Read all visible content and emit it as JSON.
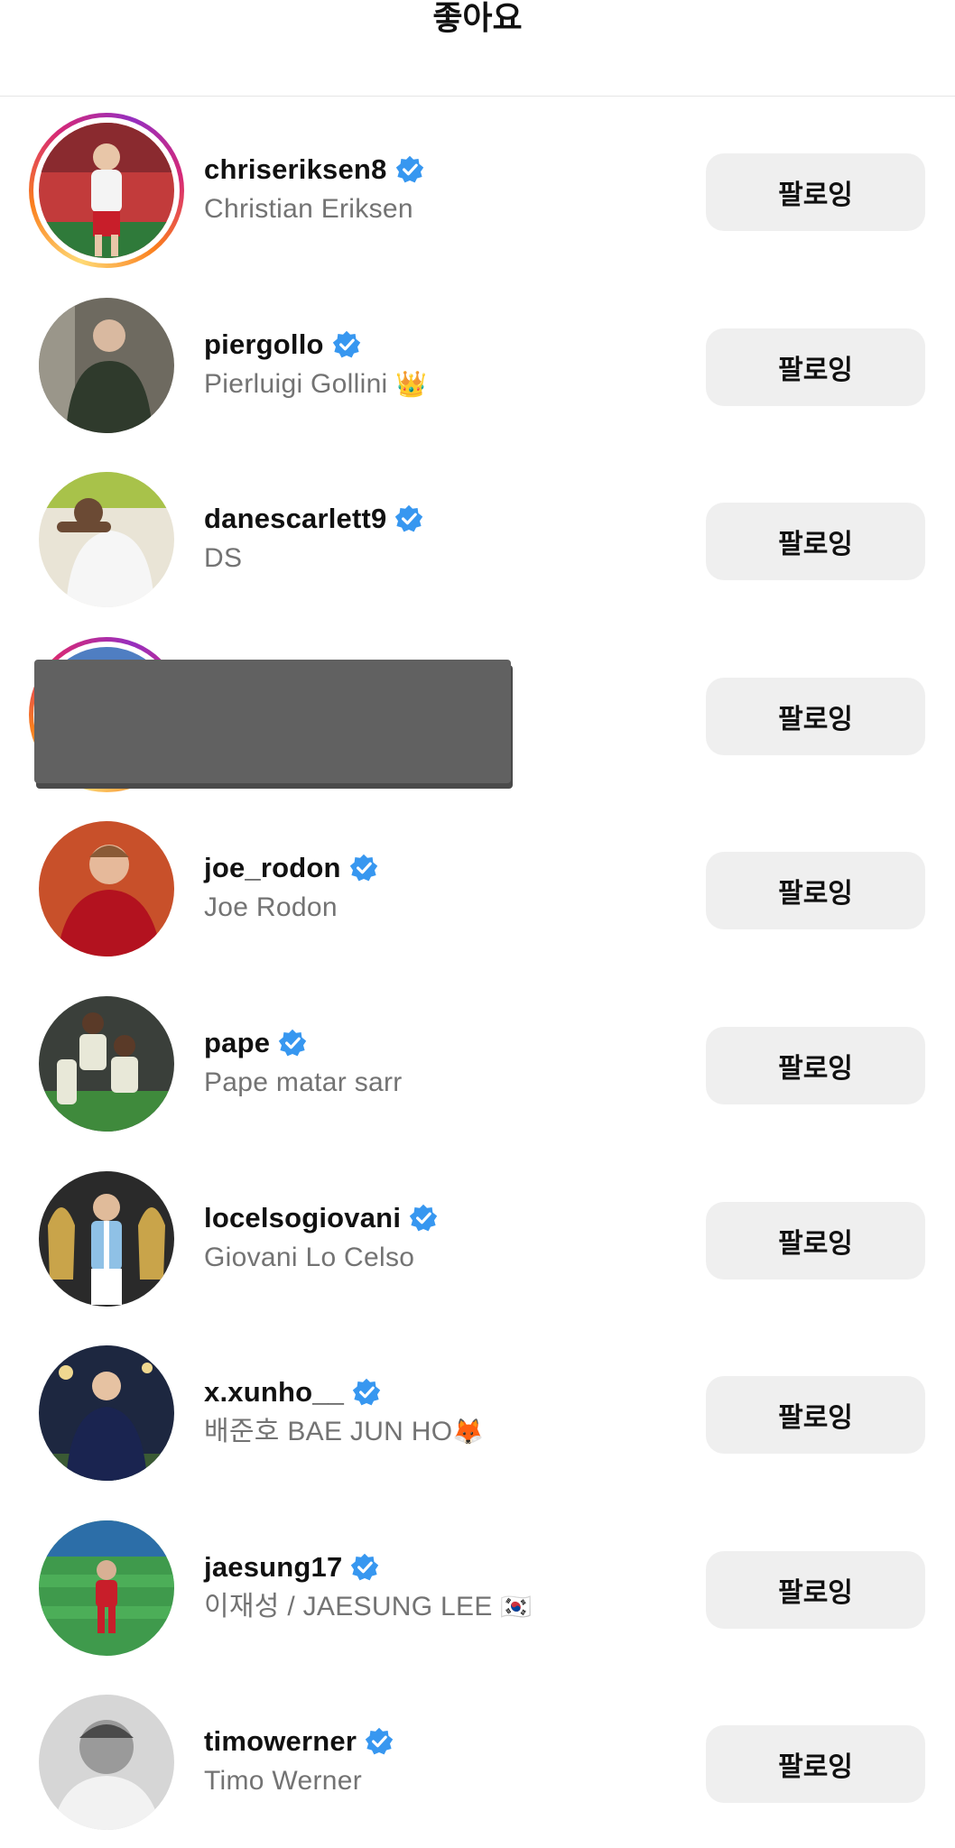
{
  "header": {
    "title": "좋아요"
  },
  "follow_label": "팔로잉",
  "colors": {
    "verified": "#3797f0",
    "button_bg": "#efefef",
    "subtext": "#737373"
  },
  "users": [
    {
      "username": "chriseriksen8",
      "fullname": "Christian Eriksen",
      "emoji": "",
      "story": true,
      "avatar": "avatar-red-kit"
    },
    {
      "username": "piergollo",
      "fullname": "Pierluigi Gollini",
      "emoji": "👑",
      "story": false,
      "avatar": "avatar-green-jacket"
    },
    {
      "username": "danescarlett9",
      "fullname": "DS",
      "emoji": "",
      "story": false,
      "avatar": "avatar-white-shirt"
    },
    {
      "username": "",
      "fullname": "",
      "emoji": "",
      "story": true,
      "avatar": "avatar-redacted",
      "redacted": true
    },
    {
      "username": "joe_rodon",
      "fullname": "Joe Rodon",
      "emoji": "",
      "story": false,
      "avatar": "avatar-red-shirt"
    },
    {
      "username": "pape",
      "fullname": "Pape matar sarr",
      "emoji": "",
      "story": false,
      "avatar": "avatar-team-celebration"
    },
    {
      "username": "locelsogiovani",
      "fullname": "Giovani Lo Celso",
      "emoji": "",
      "story": false,
      "avatar": "avatar-trophies"
    },
    {
      "username": "x.xunho__",
      "fullname": "배준호 BAE JUN HO",
      "emoji": "🦊",
      "story": false,
      "avatar": "avatar-night-jacket"
    },
    {
      "username": "jaesung17",
      "fullname": "이재성 / JAESUNG LEE",
      "emoji": "🇰🇷",
      "story": false,
      "avatar": "avatar-pitch"
    },
    {
      "username": "timowerner",
      "fullname": "Timo Werner",
      "emoji": "",
      "story": false,
      "avatar": "avatar-bw-portrait"
    }
  ]
}
